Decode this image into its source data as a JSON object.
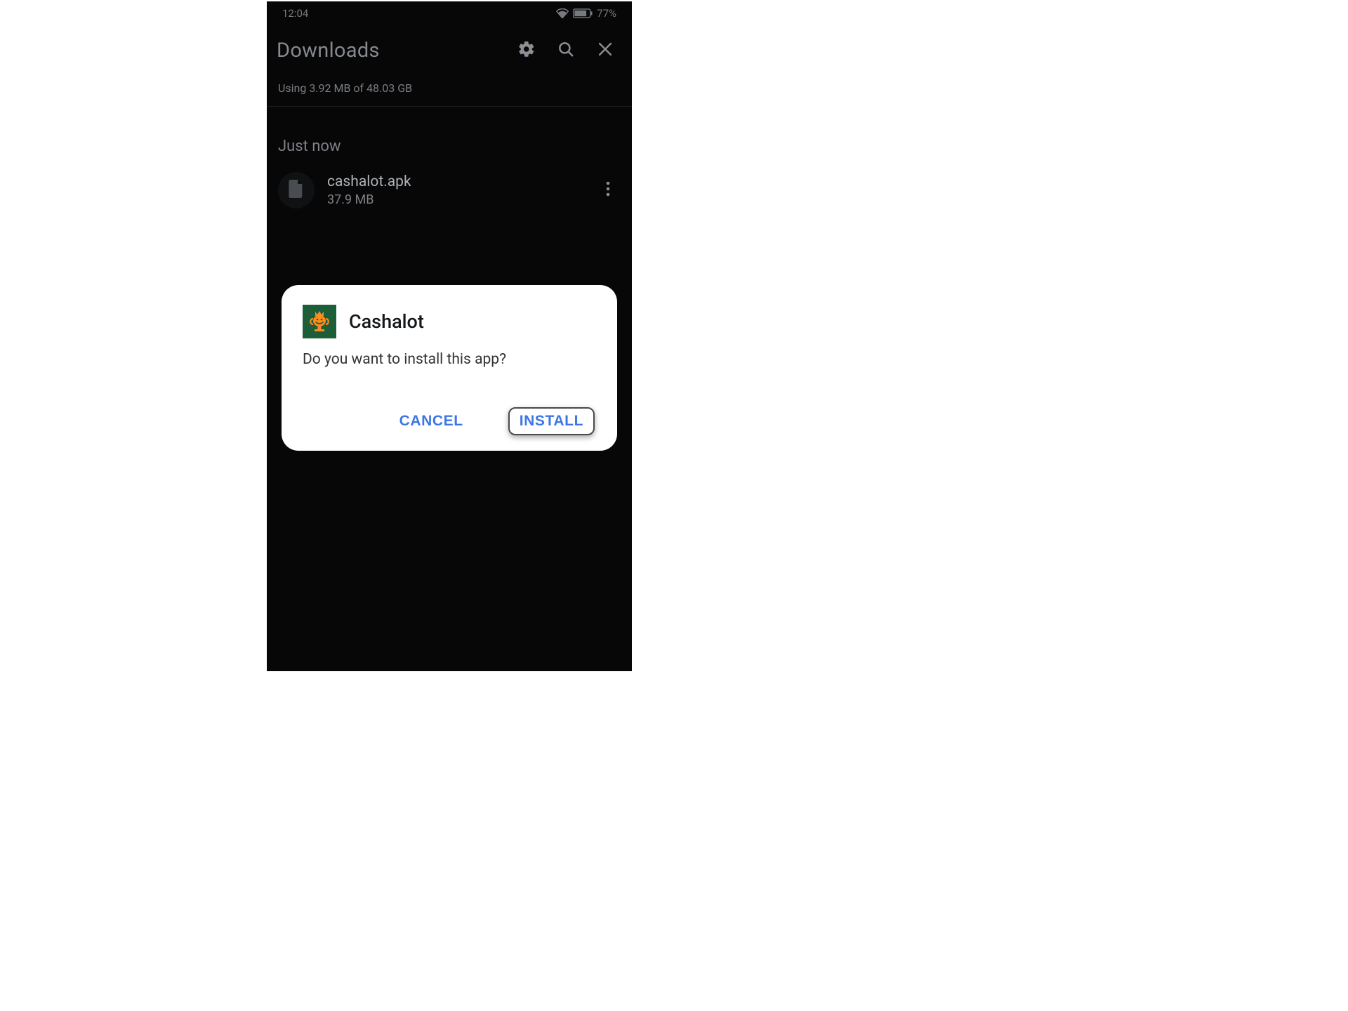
{
  "statusbar": {
    "time": "12:04",
    "battery_pct": "77%"
  },
  "header": {
    "title": "Downloads"
  },
  "usage": {
    "text": "Using 3.92 MB of 48.03 GB"
  },
  "section": {
    "label": "Just now"
  },
  "file": {
    "name": "cashalot.apk",
    "size": "37.9 MB"
  },
  "dialog": {
    "app_name": "Cashalot",
    "message": "Do you want to install this app?",
    "cancel": "CANCEL",
    "install": "INSTALL"
  }
}
